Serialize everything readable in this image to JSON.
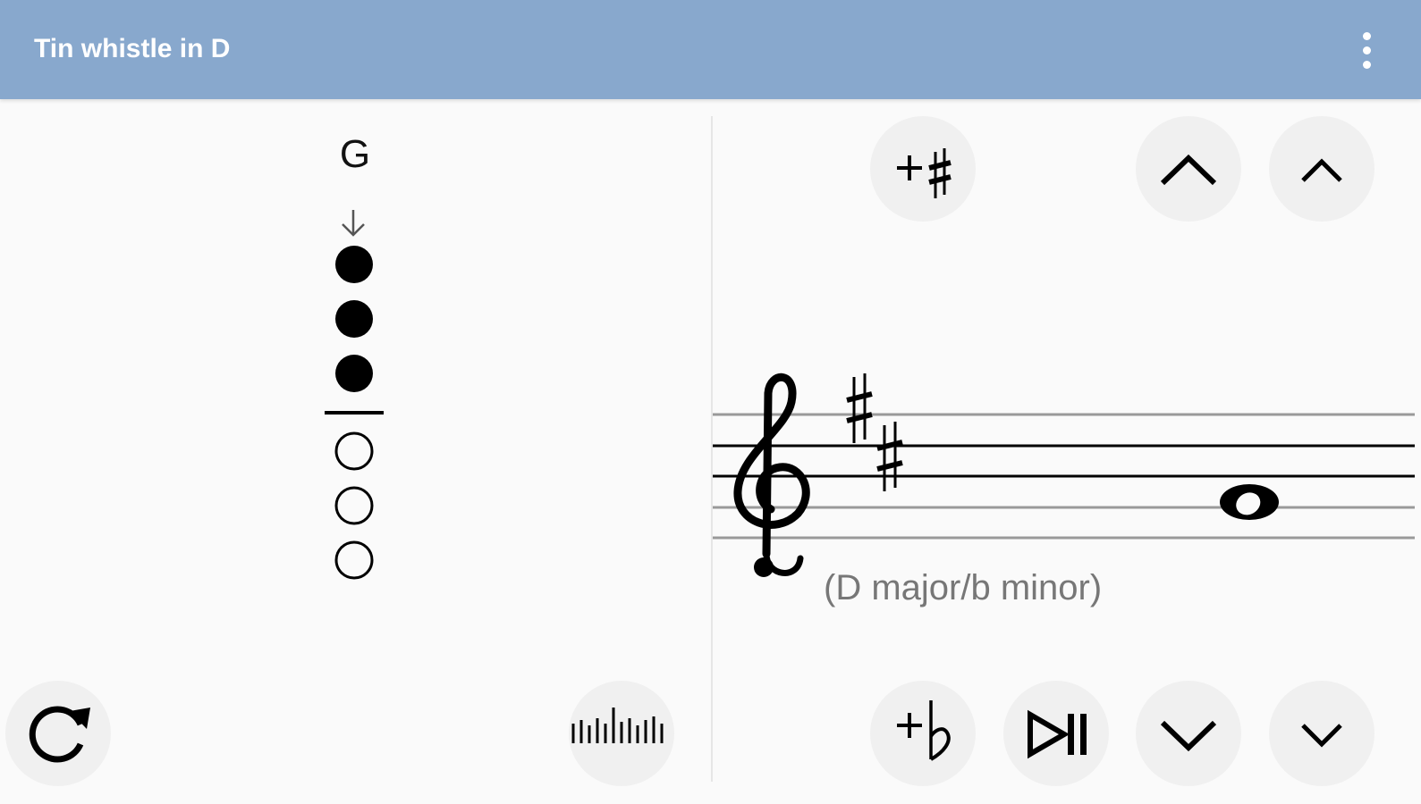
{
  "appbar": {
    "title": "Tin whistle in D",
    "menu_icon": "more-vert-icon"
  },
  "fingering": {
    "note": "G",
    "holes": [
      "closed",
      "closed",
      "closed",
      "open",
      "open",
      "open"
    ],
    "breath_icon": "arrow-down-icon"
  },
  "staff": {
    "clef": "treble-clef",
    "key_signature_sharps": 2,
    "key_label": "(D major/b minor)",
    "note_value": "whole-note"
  },
  "buttons": {
    "add_sharp": "add-sharp-icon",
    "octave_up": "octave-up-icon",
    "semitone_up": "semitone-up-icon",
    "add_flat": "add-flat-icon",
    "play_pause": "play-pause-icon",
    "octave_down": "octave-down-icon",
    "semitone_down": "semitone-down-icon",
    "rotate": "rotate-icon",
    "tuner": "tuner-icon"
  },
  "colors": {
    "appbar": "#88a8cd",
    "background": "#fafafa",
    "button": "#f0f0f0"
  }
}
